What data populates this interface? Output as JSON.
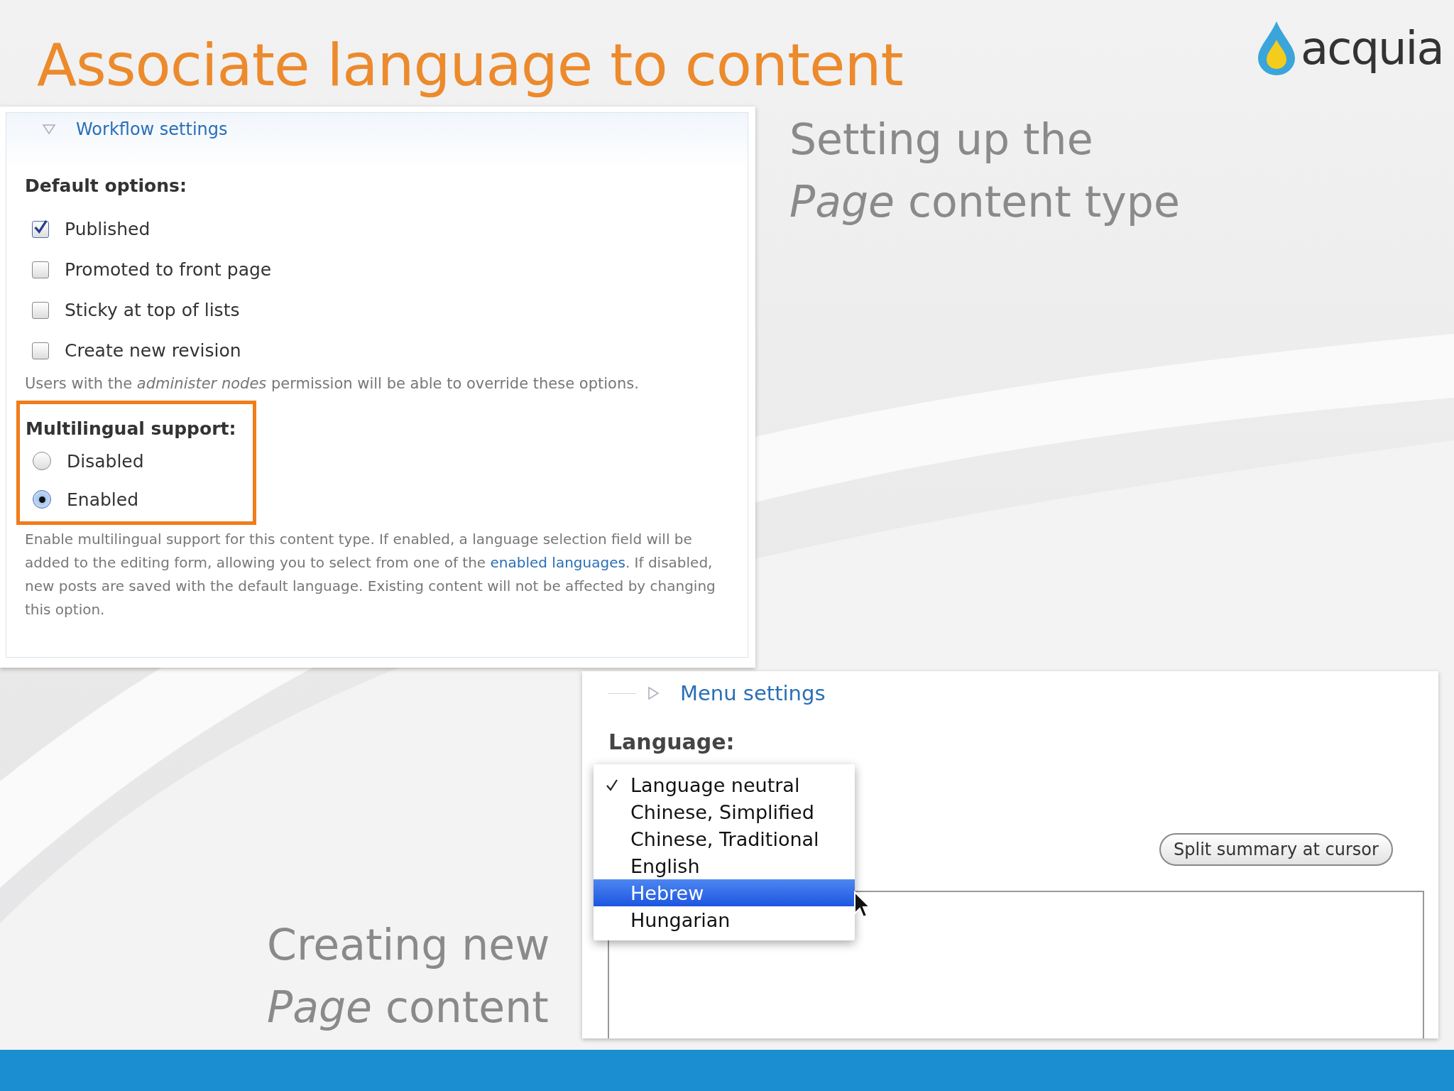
{
  "slide": {
    "title": "Associate language to content",
    "logo": "acquia"
  },
  "captions": [
    {
      "line1": "Setting up the",
      "line2": "*Page* content type",
      "kind": "top"
    },
    {
      "line1": "Creating new",
      "line2": "*Page* content",
      "kind": "bottom"
    }
  ],
  "workflow": {
    "legend": "Workflow settings",
    "expanded": true,
    "default_label": "Default options:",
    "checkboxes": [
      {
        "label": "Published",
        "checked": true
      },
      {
        "label": "Promoted to front page",
        "checked": false
      },
      {
        "label": "Sticky at top of lists",
        "checked": false
      },
      {
        "label": "Create new revision",
        "checked": false
      }
    ],
    "help": "Users with the *administer nodes* permission will be able to override these options.",
    "multilingual_label": "Multilingual support:",
    "radios": [
      {
        "label": "Disabled",
        "selected": false
      },
      {
        "label": "Enabled",
        "selected": true
      }
    ],
    "description": [
      {
        "kind": "text",
        "text": "Enable multilingual support for this content type. If enabled, a language selection field will be added to the editing form, allowing you to select from one of the "
      },
      {
        "kind": "link",
        "text": "enabled languages"
      },
      {
        "kind": "text",
        "text": ". If disabled, new posts are saved with the default language. Existing content will not be affected by changing this option."
      }
    ]
  },
  "menu": {
    "legend": "Menu settings",
    "expanded": false,
    "language_label": "Language:",
    "options": [
      {
        "label": "Language neutral",
        "checked": true,
        "highlighted": false
      },
      {
        "label": "Chinese, Simplified",
        "checked": false,
        "highlighted": false
      },
      {
        "label": "Chinese, Traditional",
        "checked": false,
        "highlighted": false
      },
      {
        "label": "English",
        "checked": false,
        "highlighted": false
      },
      {
        "label": "Hebrew",
        "checked": false,
        "highlighted": true
      },
      {
        "label": "Hungarian",
        "checked": false,
        "highlighted": false
      }
    ],
    "button": "Split summary at cursor"
  }
}
